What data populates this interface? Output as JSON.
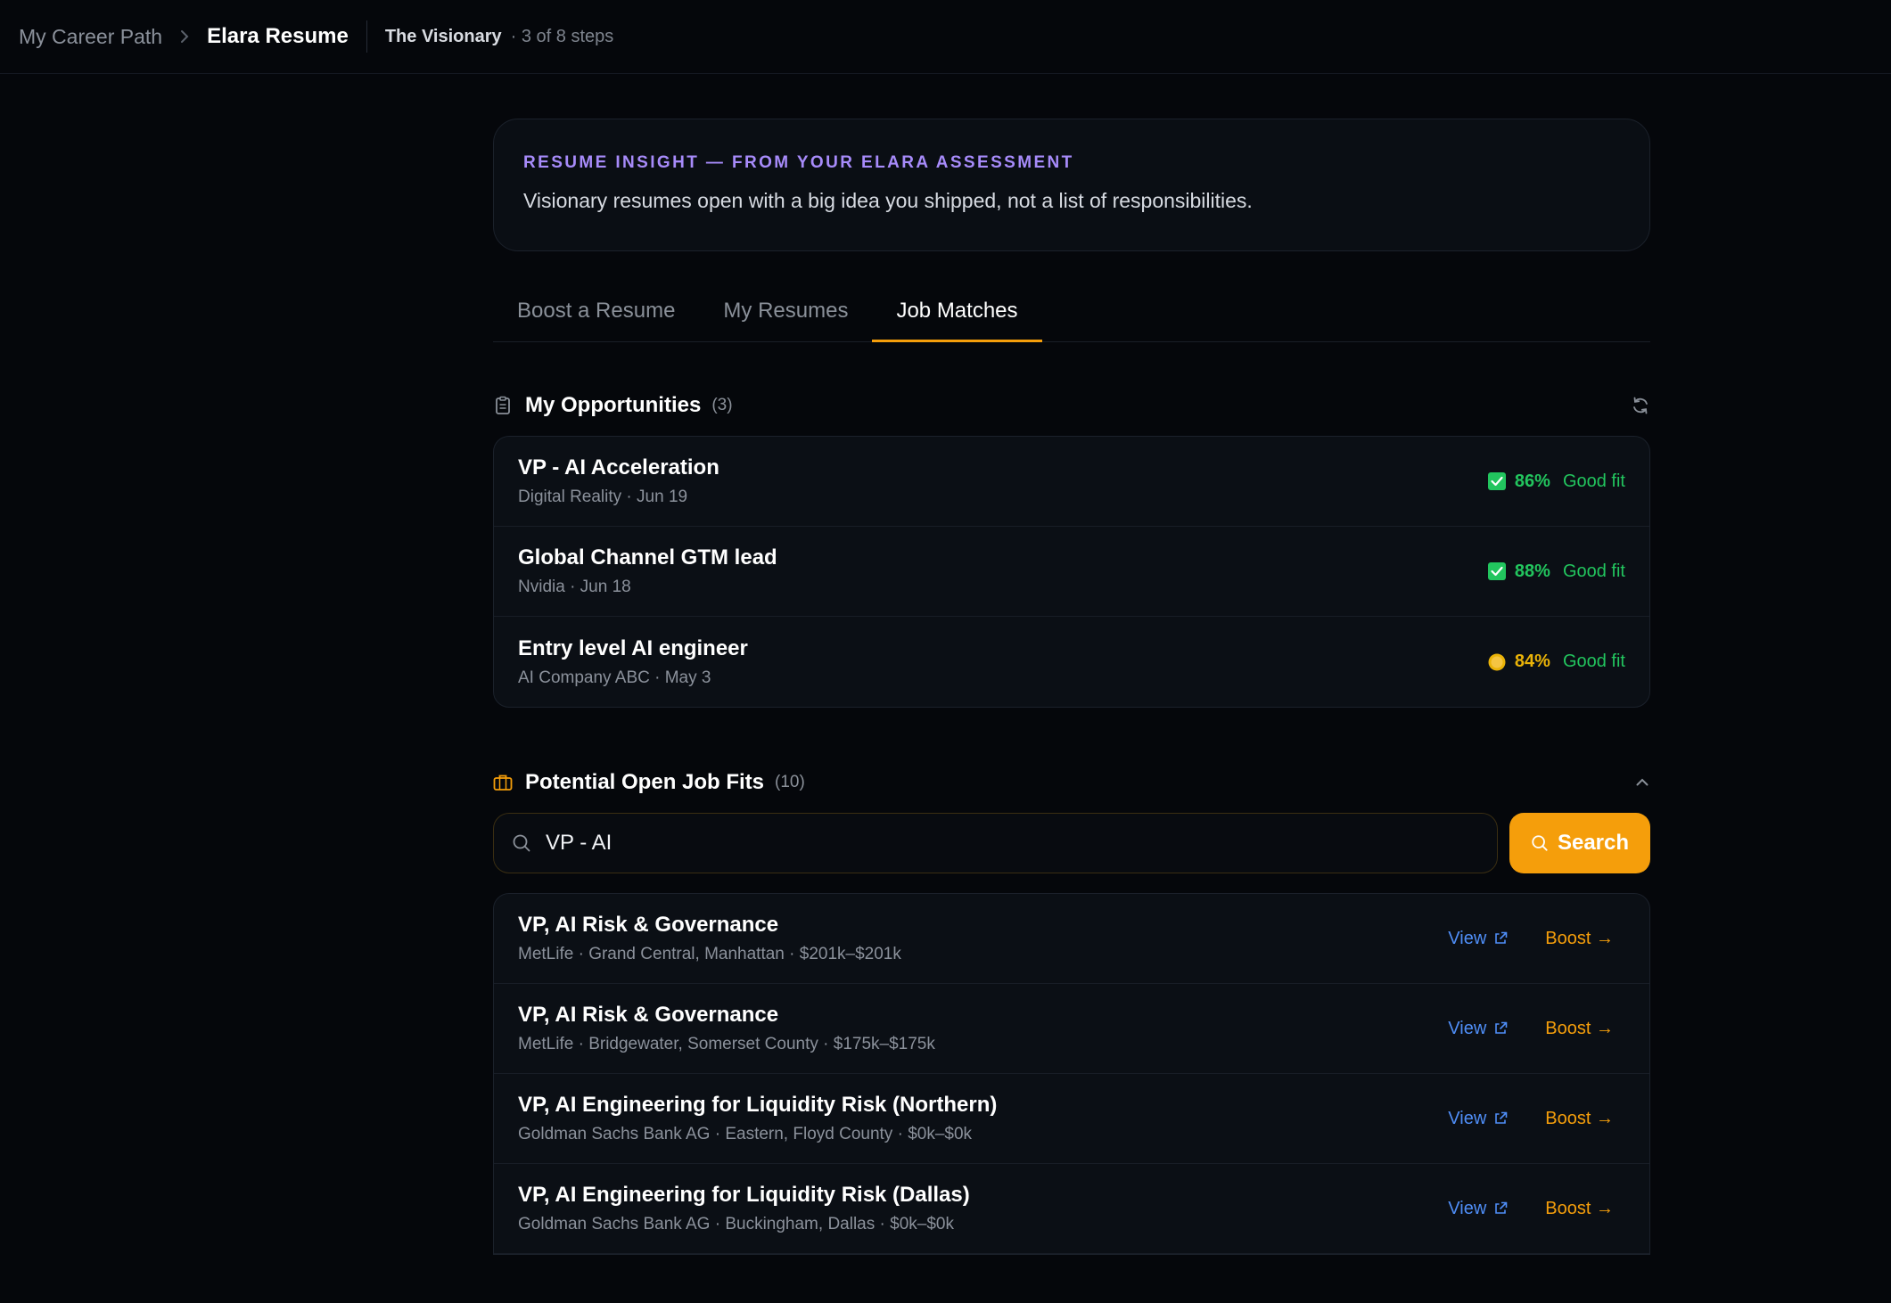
{
  "breadcrumb": {
    "root": "My Career Path",
    "current": "Elara Resume",
    "mode": "The Visionary",
    "steps": "· 3 of 8 steps"
  },
  "insight": {
    "label": "RESUME INSIGHT — FROM YOUR ELARA ASSESSMENT",
    "text": "Visionary resumes open with a big idea you shipped, not a list of responsibilities."
  },
  "tabs": [
    {
      "label": "Boost a Resume",
      "active": false
    },
    {
      "label": "My Resumes",
      "active": false
    },
    {
      "label": "Job Matches",
      "active": true
    }
  ],
  "opportunities": {
    "title": "My Opportunities",
    "count": "(3)",
    "items": [
      {
        "title": "VP - AI Acceleration",
        "meta": "Digital Reality · Jun 19",
        "score": "86%",
        "score_color": "#22c55e",
        "fit": "Good fit",
        "icon": "check-square-icon"
      },
      {
        "title": "Global Channel GTM lead",
        "meta": "Nvidia · Jun 18",
        "score": "88%",
        "score_color": "#22c55e",
        "fit": "Good fit",
        "icon": "check-square-icon"
      },
      {
        "title": "Entry level AI engineer",
        "meta": "AI Company ABC · May 3",
        "score": "84%",
        "score_color": "#eab308",
        "fit": "Good fit",
        "icon": "coin-icon"
      }
    ]
  },
  "jobs": {
    "title": "Potential Open Job Fits",
    "count": "(10)",
    "search_value": "VP - AI",
    "search_button": "Search",
    "view_label": "View",
    "boost_label": "Boost →",
    "items": [
      {
        "title": "VP, AI Risk & Governance",
        "meta": "MetLife · Grand Central, Manhattan · $201k–$201k"
      },
      {
        "title": "VP, AI Risk & Governance",
        "meta": "MetLife · Bridgewater, Somerset County · $175k–$175k"
      },
      {
        "title": "VP, AI Engineering for Liquidity Risk (Northern)",
        "meta": "Goldman Sachs Bank AG · Eastern, Floyd County · $0k–$0k"
      },
      {
        "title": "VP, AI Engineering for Liquidity Risk (Dallas)",
        "meta": "Goldman Sachs Bank AG · Buckingham, Dallas · $0k–$0k"
      }
    ]
  },
  "colors": {
    "accent": "#f59e0b",
    "insight_label": "#a78bfa",
    "good_fit": "#22c55e",
    "link": "#4f8ef7"
  }
}
